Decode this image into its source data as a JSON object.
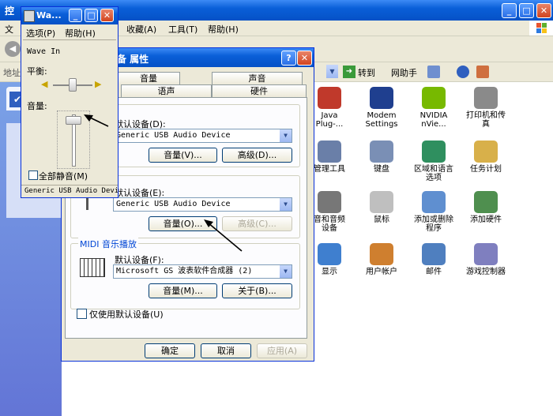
{
  "explorer": {
    "title_partial": "控",
    "menu": [
      "文",
      "收藏(A)",
      "工具(T)",
      "帮助(H)"
    ],
    "address_label": "地址",
    "go_label": "转到",
    "links_label": "网助手",
    "icons": [
      {
        "label": "Java\nPlug-...",
        "icon": "java-icon",
        "color": "#c0392b"
      },
      {
        "label": "Modem\nSettings",
        "icon": "modem-icon",
        "color": "#1f3f8f"
      },
      {
        "label": "NVIDIA\nnVie...",
        "icon": "nvidia-icon",
        "color": "#77b900"
      },
      {
        "label": "打印机和传\n真",
        "icon": "printer-icon",
        "color": "#8a8a8a"
      },
      {
        "label": "管理工具",
        "icon": "admin-tools-icon",
        "color": "#6a7fa8"
      },
      {
        "label": "键盘",
        "icon": "keyboard-icon",
        "color": "#7a8fb5"
      },
      {
        "label": "区域和语言\n选项",
        "icon": "globe-icon",
        "color": "#2f8f5f"
      },
      {
        "label": "任务计划",
        "icon": "scheduled-tasks-icon",
        "color": "#d8b04a"
      },
      {
        "label": "音和音频\n设备",
        "icon": "speaker-icon",
        "color": "#777777"
      },
      {
        "label": "鼠标",
        "icon": "mouse-icon",
        "color": "#bfbfbf"
      },
      {
        "label": "添加或删除\n程序",
        "icon": "add-remove-programs-icon",
        "color": "#5f8fd0"
      },
      {
        "label": "添加硬件",
        "icon": "add-hardware-icon",
        "color": "#4f8f4f"
      },
      {
        "label": "显示",
        "icon": "display-icon",
        "color": "#3f7fcf"
      },
      {
        "label": "用户帐户",
        "icon": "user-accounts-icon",
        "color": "#cf7f2f"
      },
      {
        "label": "邮件",
        "icon": "mail-icon",
        "color": "#4f7fbf"
      },
      {
        "label": "游戏控制器",
        "icon": "game-controller-icon",
        "color": "#7f7fbf"
      }
    ]
  },
  "dialog": {
    "title": "备 属性",
    "tabs_row1": [
      "音量",
      "声音"
    ],
    "tabs_row2": [
      "语声",
      "硬件"
    ],
    "playback": {
      "default_label": "默认设备(D):",
      "device": "Generic USB Audio Device",
      "volume_btn": "音量(V)...",
      "advanced_btn": "高级(D)..."
    },
    "recording": {
      "default_label": "默认设备(E):",
      "device": "Generic USB Audio Device",
      "volume_btn": "音量(O)...",
      "advanced_btn": "高级(C)..."
    },
    "midi": {
      "group_title": "MIDI 音乐播放",
      "default_label": "默认设备(F):",
      "device": "Microsoft GS 波表软件合成器 (2)",
      "volume_btn": "音量(M)...",
      "about_btn": "关于(B)..."
    },
    "use_default_only": "仅使用默认设备(U)",
    "ok": "确定",
    "cancel": "取消",
    "apply": "应用(A)"
  },
  "wave": {
    "title": "Wa...",
    "menu": [
      "选项(P)",
      "帮助(H)"
    ],
    "heading": "Wave In",
    "balance_label": "平衡:",
    "volume_label": "音量:",
    "mute_all": "全部静音(M)",
    "status": "Generic USB Audio Devi"
  }
}
